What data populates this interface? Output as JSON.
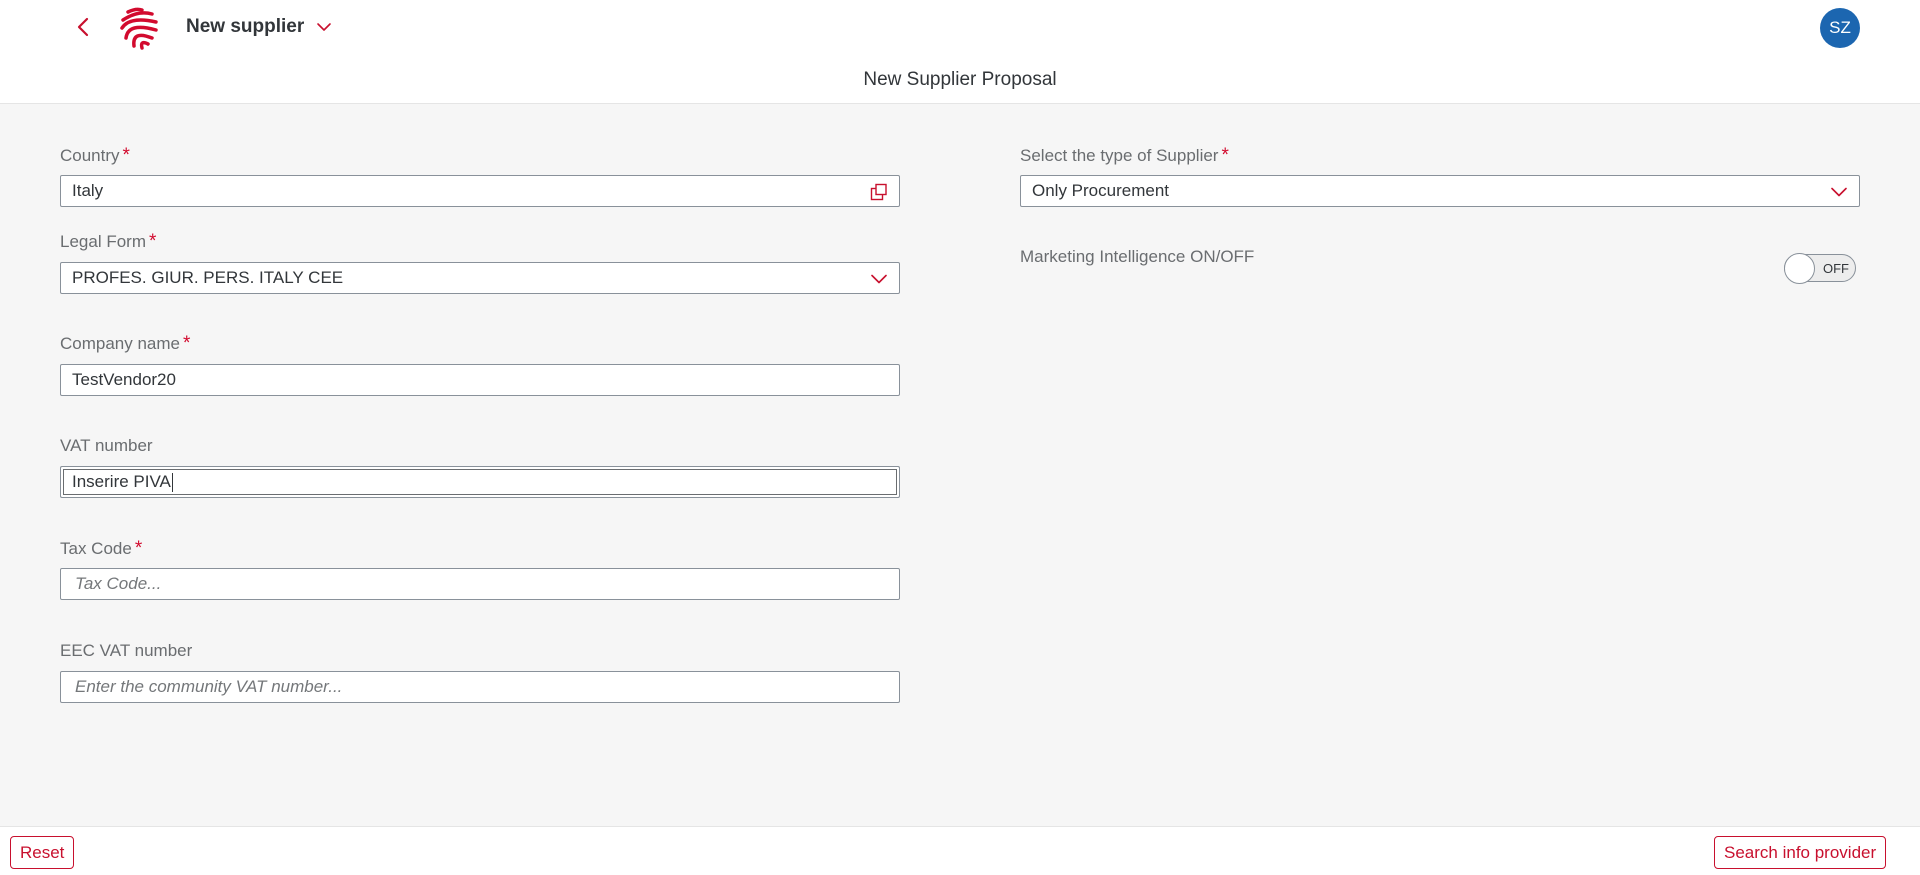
{
  "header": {
    "app_title": "New supplier",
    "user_initials": "SZ",
    "page_title": "New Supplier Proposal"
  },
  "colors": {
    "brand_red": "#c8102e",
    "required_marker": "#d20a2e",
    "avatar_blue": "#1c66b0"
  },
  "icons": [
    "back-arrow-icon",
    "company-logo",
    "chevron-down-icon",
    "value-help-icon",
    "dropdown-arrow-icon"
  ],
  "form": {
    "country": {
      "label": "Country",
      "required": "*",
      "value": "Italy"
    },
    "legal_form": {
      "label": "Legal Form",
      "required": "*",
      "value": "PROFES. GIUR. PERS. ITALY CEE"
    },
    "company_name": {
      "label": "Company name",
      "required": "*",
      "value": "TestVendor20"
    },
    "vat_number": {
      "label": "VAT number",
      "value": "Inserire PIVA"
    },
    "tax_code": {
      "label": "Tax Code",
      "required": "*",
      "placeholder": "Tax Code..."
    },
    "eec_vat": {
      "label": "EEC VAT number",
      "placeholder": "Enter the community VAT number..."
    },
    "supplier_type": {
      "label": "Select the type of Supplier",
      "required": "*",
      "value": "Only Procurement"
    },
    "marketing": {
      "label": "Marketing Intelligence ON/OFF",
      "state": "OFF"
    }
  },
  "footer": {
    "reset_label": "Reset",
    "search_label": "Search info provider"
  }
}
